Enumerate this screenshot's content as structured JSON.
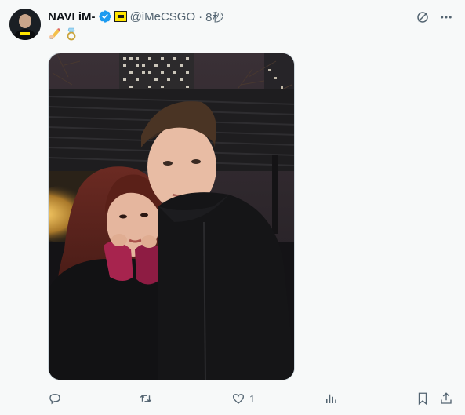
{
  "author": {
    "display_name": "NAVI iM-",
    "handle": "@iMeCSGO",
    "separator": "·",
    "time": "8秒"
  },
  "content": {
    "emoji": [
      "writing-hand",
      "ring"
    ]
  },
  "actions": {
    "reply_count": "",
    "retweet_count": "",
    "like_count": "1",
    "views_count": ""
  },
  "colors": {
    "verified": "#1d9bf0",
    "icon_gray": "#536471",
    "affiliate_badge": "#ffe500"
  }
}
